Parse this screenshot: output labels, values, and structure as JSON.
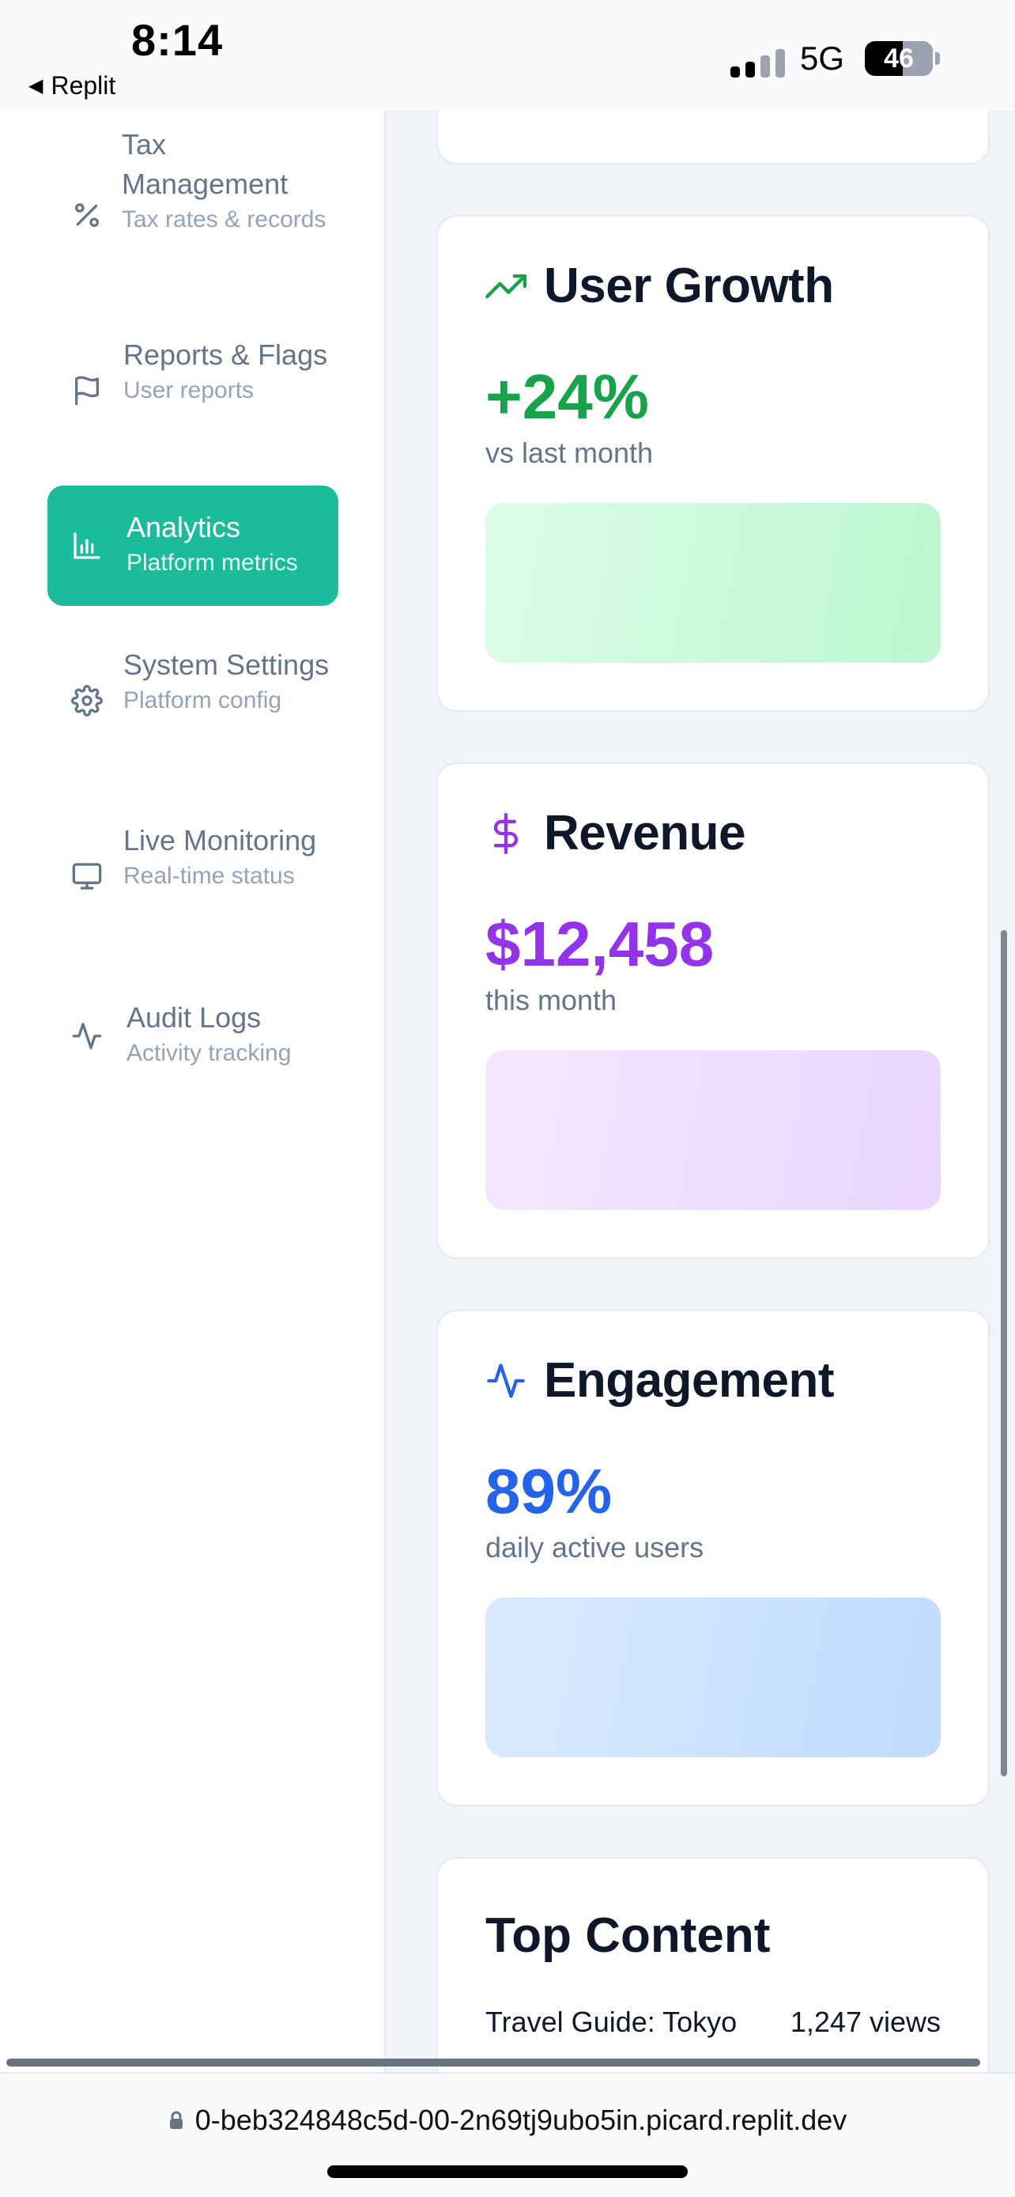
{
  "status_bar": {
    "time": "8:14",
    "back_app": "Replit",
    "network": "5G",
    "battery": "46"
  },
  "sidebar": {
    "items": [
      {
        "label": "Tax Management",
        "sub": "Tax rates & records",
        "icon": "percent-icon",
        "active": false
      },
      {
        "label": "Reports & Flags",
        "sub": "User reports",
        "icon": "flag-icon",
        "active": false
      },
      {
        "label": "Analytics",
        "sub": "Platform metrics",
        "icon": "bar-chart-icon",
        "active": true
      },
      {
        "label": "System Settings",
        "sub": "Platform config",
        "icon": "gear-icon",
        "active": false
      },
      {
        "label": "Live Monitoring",
        "sub": "Real-time status",
        "icon": "monitor-icon",
        "active": false
      },
      {
        "label": "Audit Logs",
        "sub": "Activity tracking",
        "icon": "activity-icon",
        "active": false
      }
    ]
  },
  "cards": {
    "user_growth": {
      "title": "User Growth",
      "value": "+24%",
      "sub": "vs last month",
      "color": "#16a34a",
      "icon": "trending-up-icon"
    },
    "revenue": {
      "title": "Revenue",
      "value": "$12,458",
      "sub": "this month",
      "color": "#9333ea",
      "icon": "dollar-icon"
    },
    "engagement": {
      "title": "Engagement",
      "value": "89%",
      "sub": "daily active users",
      "color": "#2563eb",
      "icon": "activity-icon"
    }
  },
  "top_content": {
    "title": "Top Content",
    "rows": [
      {
        "name": "Travel Guide: Tokyo",
        "views": "1,247 views"
      }
    ]
  },
  "url": "0-beb324848c5d-00-2n69tj9ubo5in.picard.replit.dev"
}
